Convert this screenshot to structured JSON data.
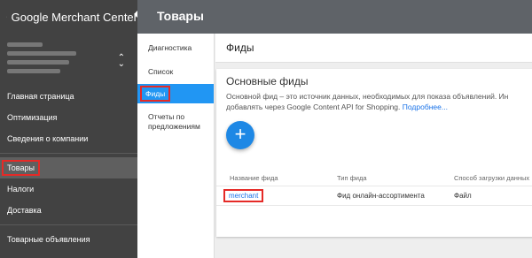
{
  "app": {
    "name": "Google Merchant Center"
  },
  "header": {
    "title": "Товары"
  },
  "sidebar": {
    "items": [
      {
        "label": "Главная страница"
      },
      {
        "label": "Оптимизация"
      },
      {
        "label": "Сведения о компании"
      },
      {
        "label": "Товары"
      },
      {
        "label": "Налоги"
      },
      {
        "label": "Доставка"
      },
      {
        "label": "Товарные объявления"
      }
    ]
  },
  "subnav": {
    "items": [
      {
        "label": "Диагностика"
      },
      {
        "label": "Список"
      },
      {
        "label": "Фиды"
      },
      {
        "label": "Отчеты по предложениям"
      }
    ]
  },
  "main": {
    "header": "Фиды",
    "section_title": "Основные фиды",
    "desc_line1": "Основной фид – это источник данных, необходимых для показа объявлений. Ин",
    "desc_line2": "добавлять через Google Content API for Shopping.",
    "desc_link": "Подробнее...",
    "add_button": "+",
    "table": {
      "columns": [
        "Название фида",
        "Тип фида",
        "Способ загрузки данных"
      ],
      "rows": [
        [
          "merchant",
          "Фид онлайн-ассортимента",
          "Файл"
        ]
      ]
    }
  },
  "colors": {
    "accent": "#2196f3",
    "highlight": "#e52a27",
    "nav_bg": "#424242",
    "topbar_bg": "#5f6368"
  }
}
